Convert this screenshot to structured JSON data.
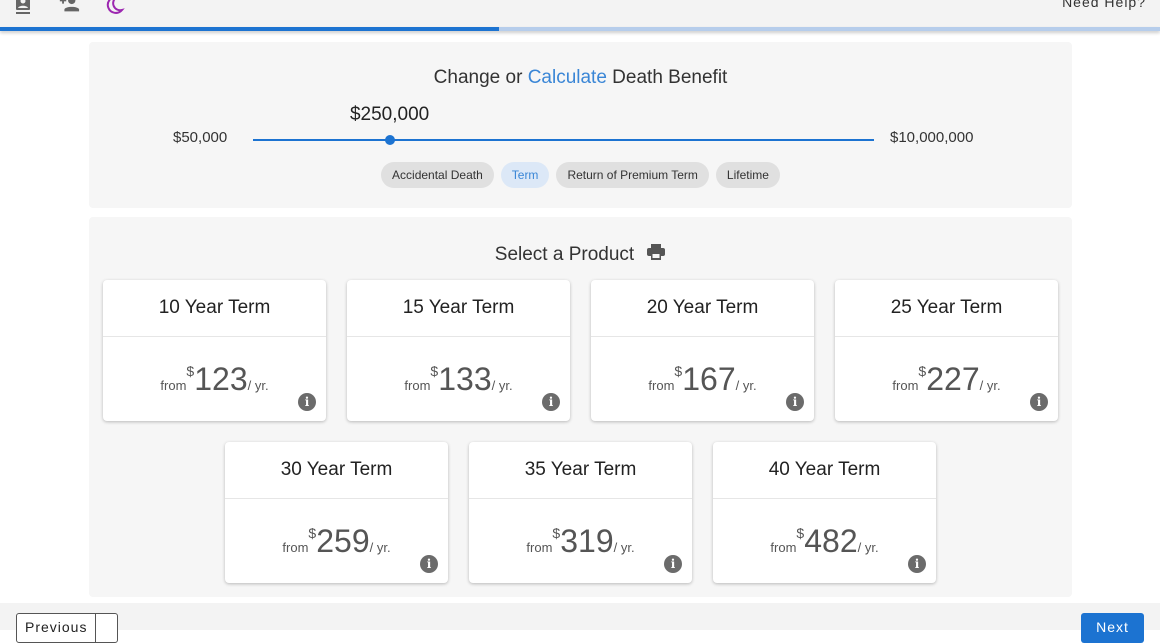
{
  "header": {
    "icons": [
      "contact-card-icon",
      "add-user-icon",
      "moon-icon"
    ],
    "help_label": "Need Help?",
    "progress_percent": 43
  },
  "benefit": {
    "title_prefix": "Change or ",
    "title_link": "Calculate",
    "title_suffix": " Death Benefit",
    "min_label": "$50,000",
    "max_label": "$10,000,000",
    "value_label": "$250,000",
    "slider_fraction": 0.22,
    "chips": [
      {
        "label": "Accidental Death",
        "active": false
      },
      {
        "label": "Term",
        "active": true
      },
      {
        "label": "Return of Premium Term",
        "active": false
      },
      {
        "label": "Lifetime",
        "active": false
      }
    ]
  },
  "products": {
    "title": "Select a Product",
    "from_label": "from",
    "currency": "$",
    "per_label": "/ yr.",
    "items": [
      {
        "name": "10 Year Term",
        "price": "123"
      },
      {
        "name": "15 Year Term",
        "price": "133"
      },
      {
        "name": "20 Year Term",
        "price": "167"
      },
      {
        "name": "25 Year Term",
        "price": "227"
      },
      {
        "name": "30 Year Term",
        "price": "259"
      },
      {
        "name": "35 Year Term",
        "price": "319"
      },
      {
        "name": "40 Year Term",
        "price": "482"
      }
    ]
  },
  "footer": {
    "previous_label": "Previous",
    "next_label": "Next"
  },
  "colors": {
    "accent": "#1c73d1",
    "link": "#3a86d6",
    "moon_icon": "#9c27b0"
  }
}
